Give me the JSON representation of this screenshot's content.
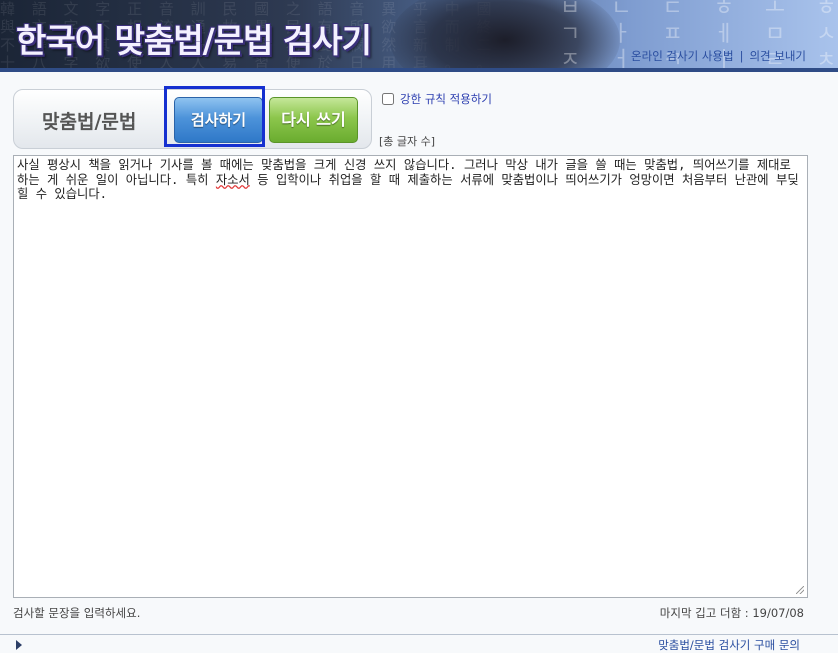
{
  "header": {
    "title": "한국어 맞춤법/문법 검사기",
    "links": [
      "온라인 검사기 사용법",
      "의견 보내기"
    ],
    "link_separator": "|"
  },
  "toolbar": {
    "label": "맞춤법/문법",
    "check_button": "검사하기",
    "reset_button": "다시 쓰기",
    "strict_option": "강한 규칙 적용하기",
    "strict_checked": false,
    "char_count": "[총 글자 수]"
  },
  "editor": {
    "text_before": "사실 평상시 책을 읽거나 기사를 볼 때에는 맞춤법을 크게 신경 쓰지 않습니다. 그러나 막상 내가 글을 쓸 때는 맞춤법, 띄어쓰기를 제대로 하는 게 쉬운 일이 아닙니다. 특히 ",
    "misspelt_word": "자소서",
    "text_after": " 등 입학이나 취업을 할 때 제출하는 서류에 맞춤법이나 띄어쓰기가 엉망이면 처음부터 난관에 부딪힐 수 있습니다."
  },
  "status": {
    "hint": "검사할 문장을 입력하세요.",
    "last_update": "마지막 깁고 더함 : 19/07/08"
  },
  "footer": {
    "link": "맞춤법/문법 검사기 구매 문의"
  },
  "colors": {
    "check_button": "#3f86d2",
    "reset_button": "#7bb83d",
    "focus_ring": "#1530d0",
    "banner_line": "#2f4c86"
  }
}
